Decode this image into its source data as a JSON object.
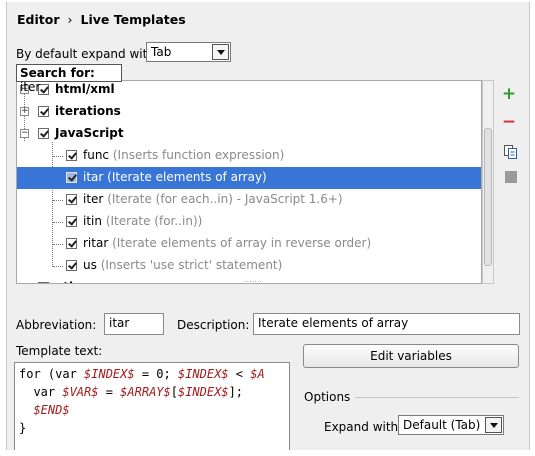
{
  "breadcrumb": {
    "first": "Editor",
    "separator": "›",
    "second": "Live Templates"
  },
  "expand": {
    "label": "By default expand with",
    "value": "Tab"
  },
  "search": {
    "label": "Search for:",
    "value": "iter"
  },
  "tree": {
    "groups": [
      {
        "name": "html/xml"
      },
      {
        "name": "iterations"
      },
      {
        "name": "JavaScript"
      },
      {
        "name": "other"
      }
    ],
    "items": [
      {
        "abbr": "func",
        "desc": "(Inserts function expression)"
      },
      {
        "abbr": "itar",
        "desc": "(Iterate elements of array)"
      },
      {
        "abbr": "iter",
        "desc": "(Iterate (for each..in) - JavaScript 1.6+)"
      },
      {
        "abbr": "itin",
        "desc": "(Iterate (for..in))"
      },
      {
        "abbr": "ritar",
        "desc": "(Iterate elements of array in reverse order)"
      },
      {
        "abbr": "us",
        "desc": "(Inserts 'use strict' statement)"
      }
    ],
    "selected_index": 1
  },
  "toolbar": {
    "add": "+",
    "remove": "−"
  },
  "form": {
    "abbreviation_label": "Abbreviation:",
    "abbreviation_value": "itar",
    "description_label": "Description:",
    "description_value": "Iterate elements of array",
    "template_text_label": "Template text:",
    "code": {
      "line1_kw": "for (var ",
      "line1_v1": "$INDEX$",
      "line1_mid": " = 0; ",
      "line1_v2": "$INDEX$",
      "line1_end": " < ",
      "line1_v3": "$A",
      "line2_kw": "  var ",
      "line2_v1": "$VAR$",
      "line2_mid": " = ",
      "line2_v2": "$ARRAY$",
      "line2_b": "[",
      "line2_v3": "$INDEX$",
      "line2_end": "];",
      "line3_v": "  $END$",
      "line4": "}"
    },
    "edit_variables_label": "Edit variables",
    "options_label": "Options",
    "expand_with_label": "Expand with",
    "expand_with_value": "Default (Tab)"
  },
  "colors": {
    "selection": "#3875d7",
    "add": "#2e9d2e",
    "remove": "#d32f2f",
    "variable": "#a21c1c"
  }
}
